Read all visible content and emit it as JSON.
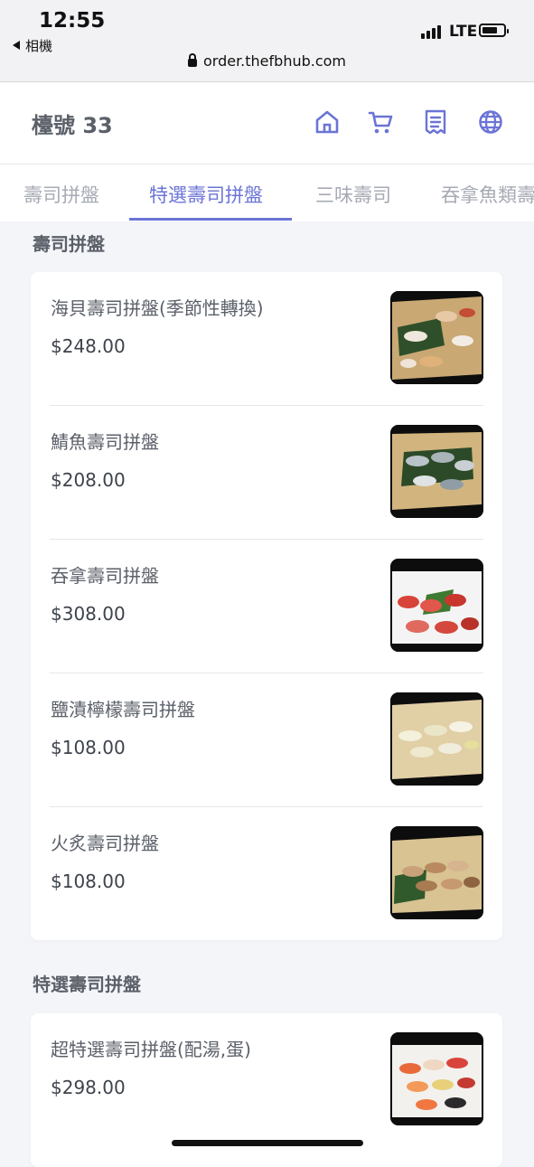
{
  "status_bar": {
    "time": "12:55",
    "back_app": "相機",
    "network": "LTE",
    "url": "order.thefbhub.com"
  },
  "header": {
    "table_label": "檯號 33",
    "icons": [
      "home-icon",
      "cart-icon",
      "receipt-icon",
      "globe-icon"
    ]
  },
  "tabs": [
    {
      "label": "壽司拼盤",
      "active": false
    },
    {
      "label": "特選壽司拼盤",
      "active": true
    },
    {
      "label": "三味壽司",
      "active": false
    },
    {
      "label": "吞拿魚類壽",
      "active": false
    }
  ],
  "sections": [
    {
      "title": "壽司拼盤",
      "items": [
        {
          "name": "海貝壽司拼盤(季節性轉換)",
          "price": "$248.00"
        },
        {
          "name": "鯖魚壽司拼盤",
          "price": "$208.00"
        },
        {
          "name": "吞拿壽司拼盤",
          "price": "$308.00"
        },
        {
          "name": "鹽漬檸檬壽司拼盤",
          "price": "$108.00"
        },
        {
          "name": "火炙壽司拼盤",
          "price": "$108.00"
        }
      ]
    },
    {
      "title": "特選壽司拼盤",
      "items": [
        {
          "name": "超特選壽司拼盤(配湯,蛋)",
          "price": "$298.00"
        }
      ]
    }
  ],
  "colors": {
    "accent": "#6b74d6",
    "background": "#f4f5f9",
    "text": "#5b6069"
  }
}
